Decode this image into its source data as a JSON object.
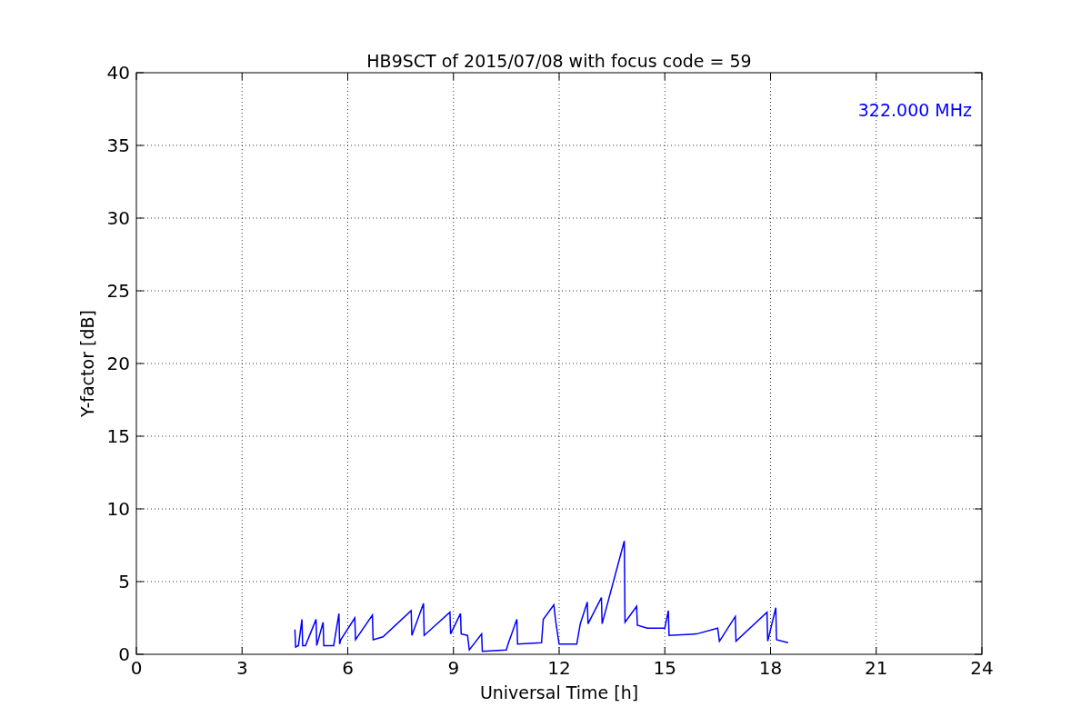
{
  "chart_data": {
    "type": "line",
    "title": "HB9SCT of 2015/07/08 with focus code = 59",
    "xlabel": "Universal Time [h]",
    "ylabel": "Y-factor [dB]",
    "x": [
      4.5,
      4.52,
      4.6,
      4.7,
      4.72,
      4.8,
      5.1,
      5.12,
      5.3,
      5.32,
      5.6,
      5.75,
      5.77,
      5.8,
      6.2,
      6.22,
      6.7,
      6.72,
      7.0,
      7.8,
      7.82,
      8.15,
      8.17,
      8.9,
      8.92,
      9.2,
      9.22,
      9.4,
      9.45,
      9.8,
      9.82,
      10.5,
      10.55,
      10.8,
      10.82,
      11.5,
      11.55,
      11.85,
      11.9,
      12.0,
      12.5,
      12.6,
      12.8,
      12.82,
      13.2,
      13.22,
      13.85,
      13.87,
      14.2,
      14.22,
      14.5,
      15.0,
      15.1,
      15.12,
      15.9,
      16.5,
      16.55,
      17.0,
      17.02,
      17.9,
      17.92,
      18.15,
      18.17,
      18.5
    ],
    "series": [
      {
        "name": "322.000 MHz",
        "color": "#0000ff",
        "values": [
          1.7,
          0.5,
          0.6,
          2.4,
          0.6,
          0.6,
          2.4,
          0.6,
          2.2,
          0.6,
          0.6,
          2.8,
          0.7,
          1.0,
          2.5,
          1.0,
          2.7,
          1.0,
          1.2,
          3.0,
          1.3,
          3.5,
          1.3,
          2.9,
          1.4,
          2.8,
          1.4,
          1.3,
          0.3,
          1.4,
          0.2,
          0.3,
          0.7,
          2.4,
          0.7,
          0.8,
          2.4,
          3.4,
          2.3,
          0.7,
          0.7,
          2.1,
          3.6,
          2.1,
          3.9,
          2.1,
          7.8,
          2.2,
          3.3,
          2.0,
          1.8,
          1.8,
          3.0,
          1.3,
          1.4,
          1.8,
          0.9,
          2.6,
          0.9,
          2.9,
          0.9,
          3.2,
          1.0,
          0.8
        ]
      }
    ],
    "xlim": [
      0,
      24
    ],
    "ylim": [
      0,
      40
    ],
    "xticks": [
      0,
      3,
      6,
      9,
      12,
      15,
      18,
      21,
      24
    ],
    "yticks": [
      0,
      5,
      10,
      15,
      20,
      25,
      30,
      35,
      40
    ],
    "grid": true
  }
}
